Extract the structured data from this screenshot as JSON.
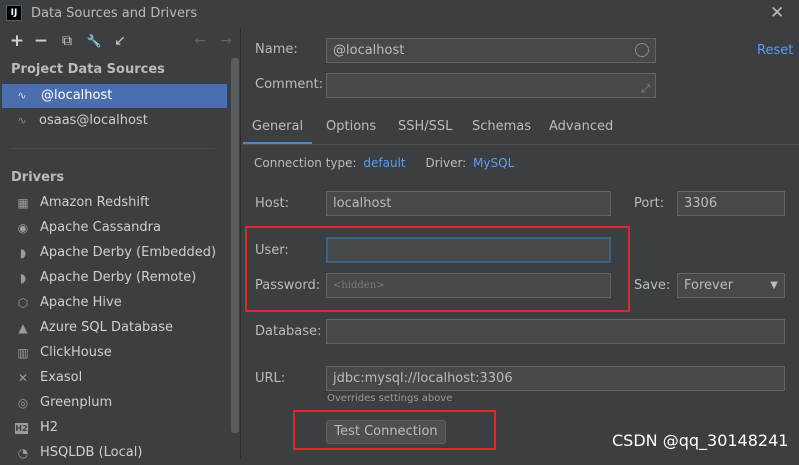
{
  "window": {
    "title": "Data Sources and Drivers",
    "app_icon_text": "IJ",
    "close_glyph": "✕"
  },
  "toolbar": {
    "add_glyph": "+",
    "remove_glyph": "−",
    "copy_glyph": "⧉",
    "settings_glyph": "🔧",
    "import_glyph": "↙",
    "back_glyph": "←",
    "forward_glyph": "→"
  },
  "project_sources": {
    "heading": "Project Data Sources",
    "items": [
      {
        "label": "@localhost",
        "selected": true
      },
      {
        "label": "osaas@localhost",
        "selected": false
      }
    ]
  },
  "drivers": {
    "heading": "Drivers",
    "items": [
      {
        "label": "Amazon Redshift",
        "icon": "redshift-icon",
        "glyph": "▦"
      },
      {
        "label": "Apache Cassandra",
        "icon": "cassandra-icon",
        "glyph": "◉"
      },
      {
        "label": "Apache Derby (Embedded)",
        "icon": "derby-icon",
        "glyph": "◗"
      },
      {
        "label": "Apache Derby (Remote)",
        "icon": "derby-icon",
        "glyph": "◗"
      },
      {
        "label": "Apache Hive",
        "icon": "hive-icon",
        "glyph": "⬡"
      },
      {
        "label": "Azure SQL Database",
        "icon": "azure-icon",
        "glyph": "▲"
      },
      {
        "label": "ClickHouse",
        "icon": "clickhouse-icon",
        "glyph": "▥"
      },
      {
        "label": "Exasol",
        "icon": "exasol-icon",
        "glyph": "✕"
      },
      {
        "label": "Greenplum",
        "icon": "greenplum-icon",
        "glyph": "◎"
      },
      {
        "label": "H2",
        "icon": "h2-icon",
        "glyph": "H2"
      },
      {
        "label": "HSQLDB (Local)",
        "icon": "hsqldb-icon",
        "glyph": "◔"
      }
    ]
  },
  "form": {
    "name_label": "Name:",
    "name_value": "@localhost",
    "reset_label": "Reset",
    "comment_label": "Comment:",
    "comment_value": "",
    "tabs": [
      {
        "label": "General",
        "active": true
      },
      {
        "label": "Options",
        "active": false
      },
      {
        "label": "SSH/SSL",
        "active": false
      },
      {
        "label": "Schemas",
        "active": false
      },
      {
        "label": "Advanced",
        "active": false
      }
    ],
    "conn_type_label": "Connection type:",
    "conn_type_value": "default",
    "driver_label": "Driver:",
    "driver_value": "MySQL",
    "host_label": "Host:",
    "host_value": "localhost",
    "port_label": "Port:",
    "port_value": "3306",
    "user_label": "User:",
    "user_value": "",
    "password_label": "Password:",
    "password_placeholder": "<hidden>",
    "save_label": "Save:",
    "save_value": "Forever",
    "database_label": "Database:",
    "database_value": "",
    "url_label": "URL:",
    "url_value": "jdbc:mysql://localhost:3306",
    "url_hint": "Overrides settings above",
    "test_button_label": "Test Connection"
  },
  "watermark": "CSDN @qq_30148241",
  "colors": {
    "accent": "#4b6eaf",
    "link": "#589df6",
    "highlight": "#e0262a",
    "background": "#3c3f41"
  }
}
